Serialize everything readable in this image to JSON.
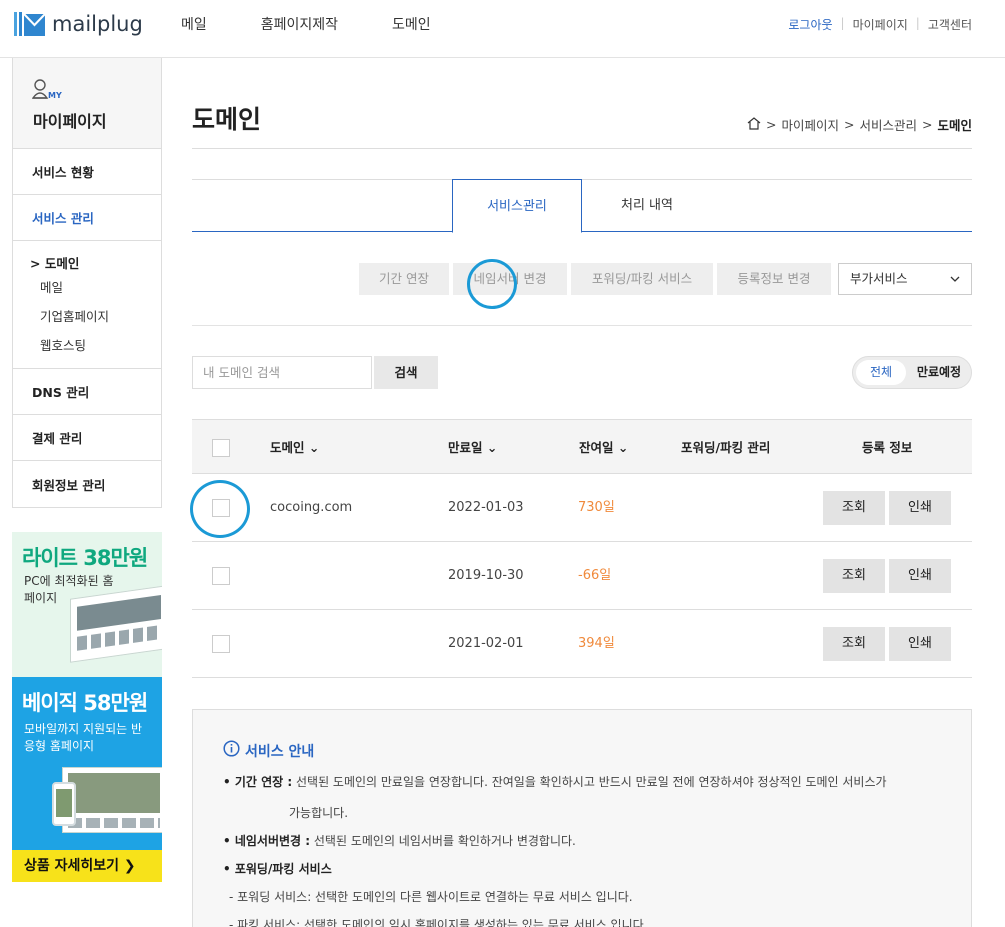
{
  "header": {
    "brand": "mailplug",
    "nav": [
      "메일",
      "홈페이지제작",
      "도메인"
    ],
    "util": [
      "로그아웃",
      "마이페이지",
      "고객센터"
    ]
  },
  "sidebar": {
    "title": "마이페이지",
    "my_badge": "MY",
    "items": [
      "서비스 현황",
      "서비스 관리"
    ],
    "current": "> 도메인",
    "subs": [
      "메일",
      "기업홈페이지",
      "웹호스팅"
    ],
    "items_after": [
      "DNS 관리",
      "결제 관리",
      "회원정보 관리"
    ]
  },
  "banner": {
    "headline1": "라이트 38만원",
    "desc1": "PC에 최적화된 홈페이지",
    "headline2": "베이직 58만원",
    "desc2": "모바일까지 지원되는 반응형 홈페이지",
    "cta": "상품 자세히보기 ❯"
  },
  "page": {
    "title": "도메인",
    "breadcrumb": [
      "마이페이지",
      "서비스관리",
      "도메인"
    ]
  },
  "tabs": [
    "서비스관리",
    "처리 내역"
  ],
  "actions": [
    "기간 연장",
    "네임서버 변경",
    "포워딩/파킹 서비스",
    "등록정보 변경"
  ],
  "addon_select": "부가서비스",
  "search": {
    "placeholder": "내 도메인 검색",
    "button": "검색"
  },
  "filter": {
    "all": "전체",
    "expiring": "만료예정"
  },
  "table": {
    "headers": [
      "도메인 ⌄",
      "만료일 ⌄",
      "잔여일 ⌄",
      "포워딩/파킹 관리",
      "등록 정보"
    ],
    "rows": [
      {
        "domain": "cocoing.com",
        "expire": "2022-01-03",
        "remain": "730일"
      },
      {
        "domain": "",
        "expire": "2019-10-30",
        "remain": "-66일"
      },
      {
        "domain": "",
        "expire": "2021-02-01",
        "remain": "394일"
      }
    ],
    "view_label": "조회",
    "print_label": "인쇄"
  },
  "notice": {
    "title": "서비스 안내",
    "lines": [
      {
        "bold": "• 기간 연장 :",
        "text": " 선택된 도메인의 만료일을 연장합니다. 잔여일을 확인하시고 반드시 만료일 전에 연장하셔야 정상적인 도메인 서비스가"
      },
      {
        "bold": "",
        "text": "가능합니다."
      },
      {
        "bold": "• 네임서버변경 :",
        "text": " 선택된 도메인의 네임서버를 확인하거나 변경합니다."
      },
      {
        "bold": "• 포워딩/파킹 서비스",
        "text": ""
      },
      {
        "bold": "",
        "text": "- 포워딩 서비스: 선택한 도메인의 다른 웹사이트로 연결하는 무료 서비스 입니다."
      },
      {
        "bold": "",
        "text": "- 파킹 서비스: 선택한 도메인의 임시 홈페이지를 생성하는 있는 무료 서비스 입니다."
      }
    ]
  },
  "colors": {
    "accent": "#2a66c2",
    "remain": "#f08a3c",
    "circle": "#1b9ad6"
  }
}
